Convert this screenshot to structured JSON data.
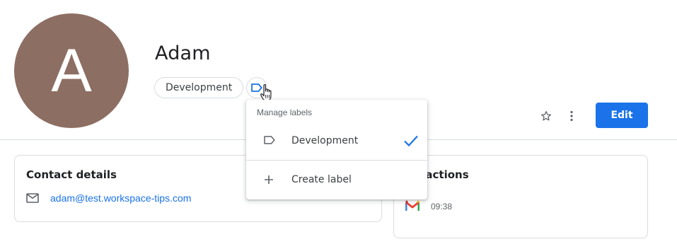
{
  "contact": {
    "avatar_initial": "A",
    "name": "Adam",
    "label_chip": "Development"
  },
  "actions": {
    "star_icon": "star-outline-icon",
    "more_icon": "more-vert-icon",
    "edit_label": "Edit"
  },
  "label_menu": {
    "header": "Manage labels",
    "items": [
      {
        "label": "Development",
        "icon": "label-icon",
        "checked": true
      },
      {
        "label": "Create label",
        "icon": "plus-icon"
      }
    ]
  },
  "contact_details": {
    "title": "Contact details",
    "email": "adam@test.workspace-tips.com"
  },
  "interactions": {
    "title_visible": "ractions",
    "items": [
      {
        "icon": "gmail-icon",
        "time": "09:38"
      }
    ]
  },
  "colors": {
    "avatar_bg": "#8d6e63",
    "accent": "#1a73e8",
    "divider": "#dadce0"
  }
}
